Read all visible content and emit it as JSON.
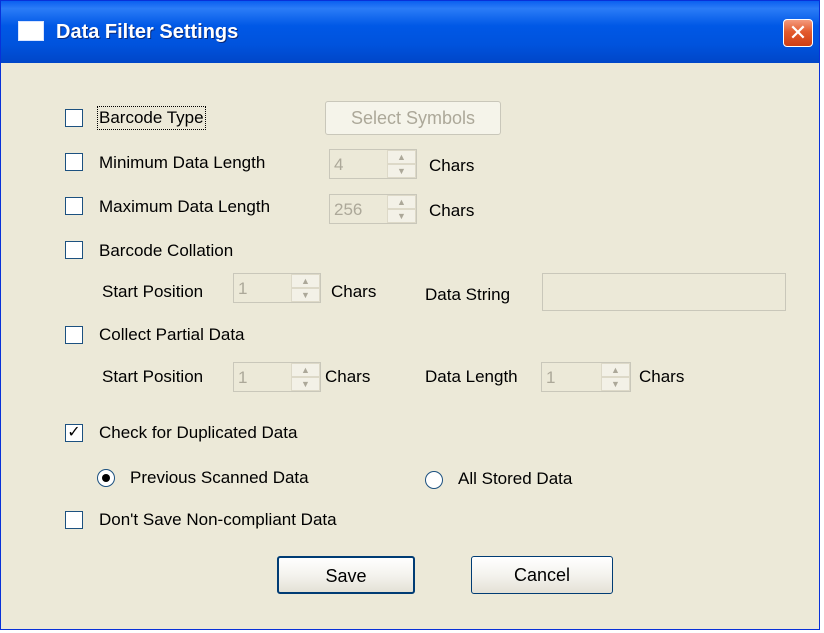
{
  "window": {
    "title": "Data Filter Settings",
    "close_glyph": "✕",
    "accent": "#0055e5"
  },
  "barcode_type": {
    "label": "Barcode Type",
    "checked": false,
    "select_symbols_label": "Select Symbols"
  },
  "min_length": {
    "label": "Minimum Data Length",
    "value": "4",
    "unit": "Chars",
    "checked": false
  },
  "max_length": {
    "label": "Maximum Data Length",
    "value": "256",
    "unit": "Chars",
    "checked": false
  },
  "collation": {
    "label": "Barcode Collation",
    "checked": false,
    "start_label": "Start Position",
    "start_value": "1",
    "unit": "Chars",
    "data_string_label": "Data String",
    "data_string_value": ""
  },
  "partial": {
    "label": "Collect Partial Data",
    "checked": false,
    "start_label": "Start Position",
    "start_value": "1",
    "unit": "Chars",
    "length_label": "Data Length",
    "length_value": "1",
    "length_unit": "Chars"
  },
  "duplicates": {
    "label": "Check for Duplicated Data",
    "checked": true,
    "option_previous": "Previous Scanned Data",
    "option_all": "All Stored Data",
    "selected": "previous"
  },
  "noncompliant": {
    "label": "Don't Save Non-compliant Data",
    "checked": false
  },
  "buttons": {
    "save": "Save",
    "cancel": "Cancel"
  },
  "icons": {
    "check": "✓",
    "spin_up": "▲",
    "spin_down": "▼"
  }
}
